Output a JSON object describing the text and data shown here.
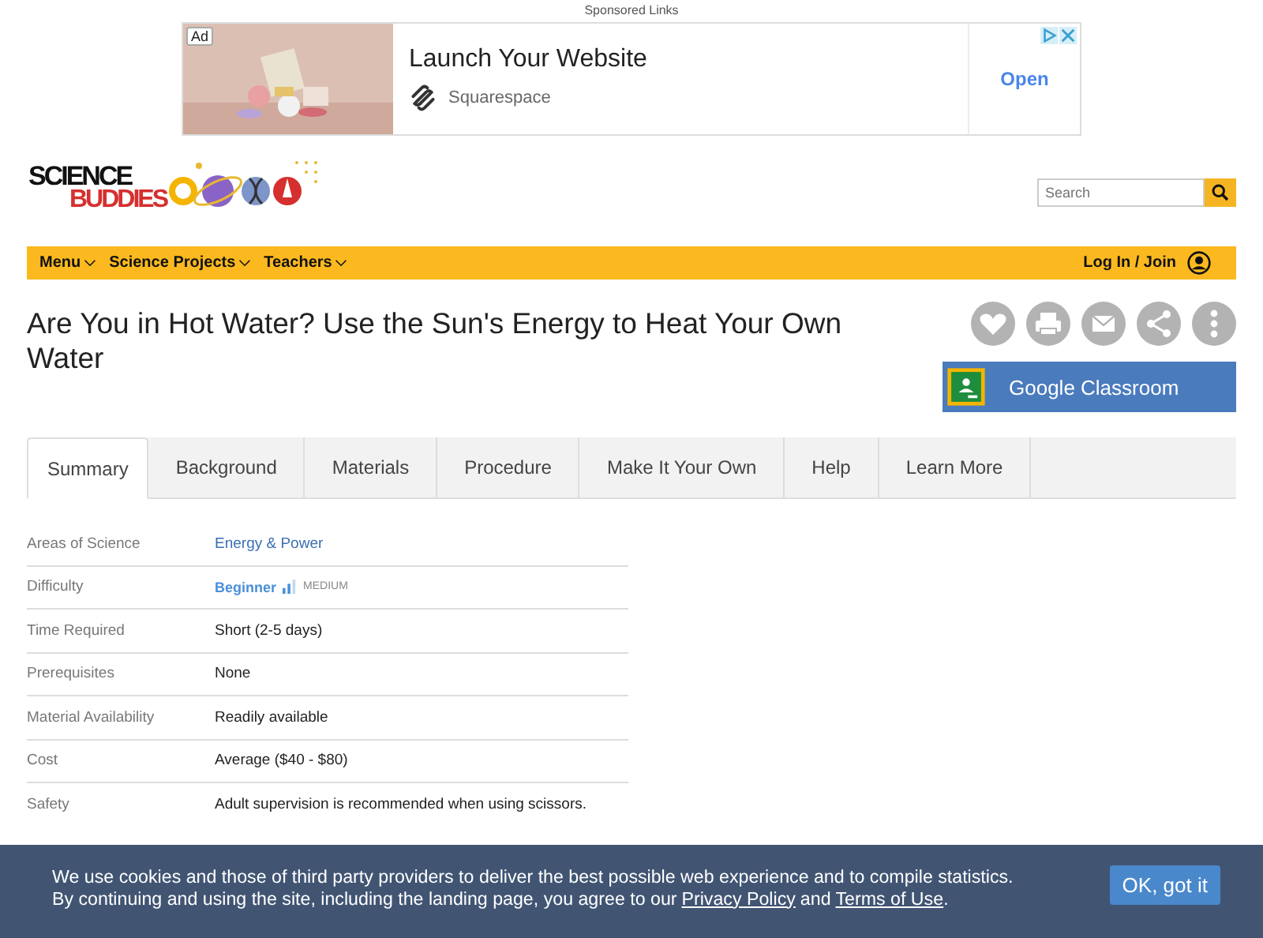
{
  "ad": {
    "sponsored_label": "Sponsored Links",
    "badge": "Ad",
    "title": "Launch Your Website",
    "advertiser": "Squarespace",
    "button": "Open"
  },
  "header": {
    "logo": {
      "line_1": "SCIENCE",
      "line_2": "BUDDIES"
    },
    "search": {
      "placeholder": "Search"
    }
  },
  "nav": {
    "items": [
      {
        "label": "Menu"
      },
      {
        "label": "Science Projects"
      },
      {
        "label": "Teachers"
      }
    ],
    "login": "Log In / Join"
  },
  "page_title": "Are You in Hot Water? Use the Sun's Energy to Heat Your Own Water",
  "actions": {
    "classroom_button": "Google Classroom"
  },
  "tabs": [
    {
      "label": "Summary",
      "selected": true
    },
    {
      "label": "Background",
      "selected": false
    },
    {
      "label": "Materials",
      "selected": false
    },
    {
      "label": "Procedure",
      "selected": false
    },
    {
      "label": "Make It Your Own",
      "selected": false
    },
    {
      "label": "Help",
      "selected": false
    },
    {
      "label": "Learn More",
      "selected": false
    }
  ],
  "summary": [
    {
      "kind": "link",
      "label": "Areas of Science",
      "value": "Energy & Power"
    },
    {
      "kind": "difficulty",
      "label": "Difficulty",
      "value": "Beginner",
      "note": "MEDIUM"
    },
    {
      "kind": "text",
      "label": "Time Required",
      "value": "Short (2-5 days)"
    },
    {
      "kind": "text",
      "label": "Prerequisites",
      "value": "None"
    },
    {
      "kind": "text",
      "label": "Material Availability",
      "value": "Readily available"
    },
    {
      "kind": "text",
      "label": "Cost",
      "value": "Average ($40 - $80)"
    },
    {
      "kind": "text",
      "label": "Safety",
      "value": "Adult supervision is recommended when using scissors."
    }
  ],
  "cookie_banner": {
    "line_1": "We use cookies and those of third party providers to deliver the best possible web experience and to compile statistics.",
    "line_2_start": "By continuing and using the site, including the landing page, you agree to our",
    "privacy_link": "Privacy Policy",
    "joiner": "and",
    "terms_link": "Terms of Use",
    "end": ".",
    "button": "OK, got it"
  }
}
